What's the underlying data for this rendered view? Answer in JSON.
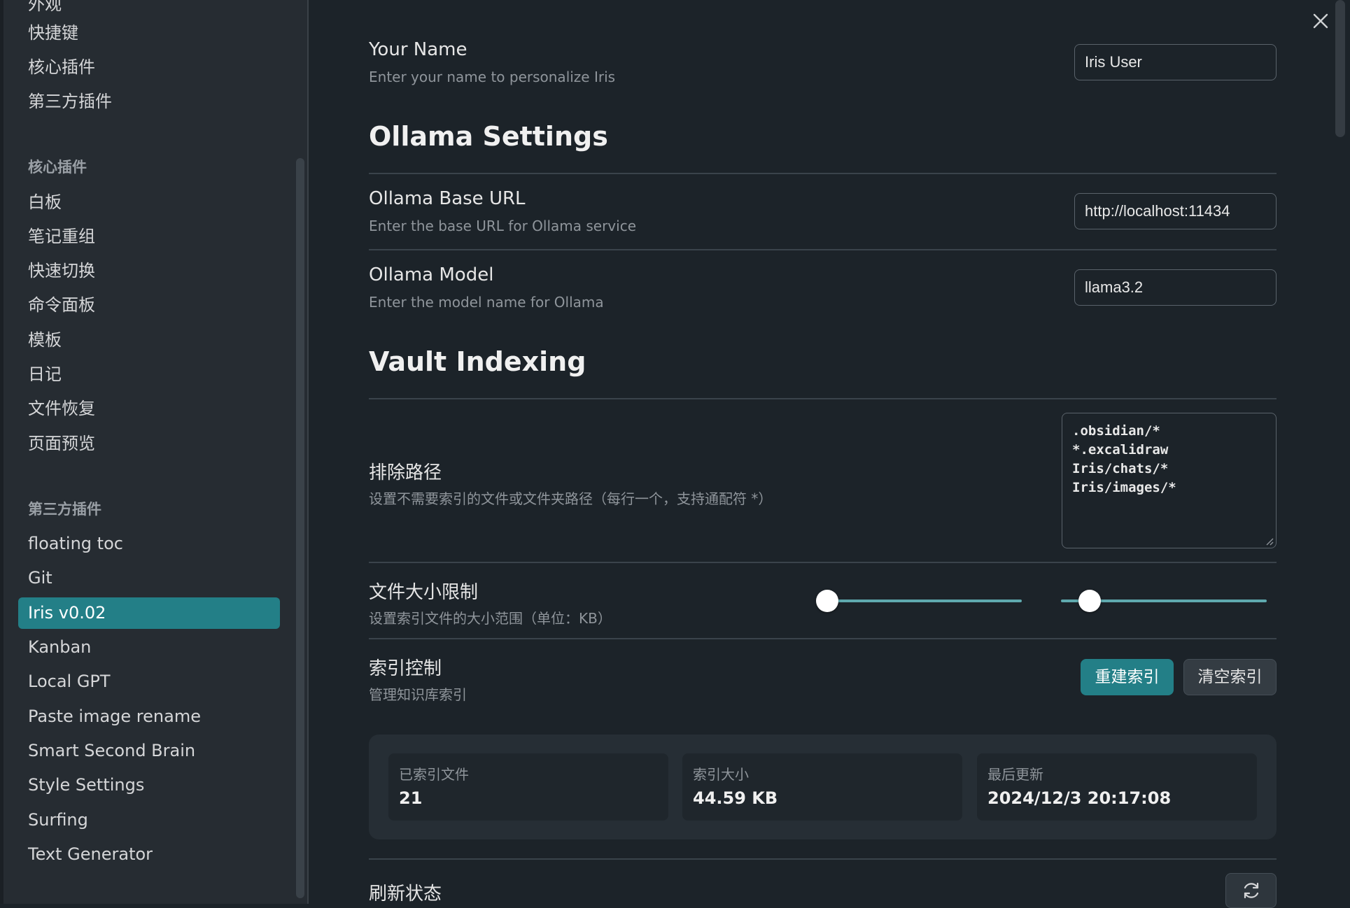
{
  "sidebar": {
    "items_top": [
      "外观",
      "快捷键",
      "核心插件",
      "第三方插件"
    ],
    "core_heading": "核心插件",
    "core_items": [
      "白板",
      "笔记重组",
      "快速切换",
      "命令面板",
      "模板",
      "日记",
      "文件恢复",
      "页面预览"
    ],
    "third_heading": "第三方插件",
    "third_items": [
      "floating toc",
      "Git",
      "Iris v0.02",
      "Kanban",
      "Local GPT",
      "Paste image rename",
      "Smart Second Brain",
      "Style Settings",
      "Surfing",
      "Text Generator"
    ],
    "active_item": "Iris v0.02"
  },
  "settings": {
    "your_name": {
      "name": "Your Name",
      "desc": "Enter your name to personalize Iris",
      "value": "Iris User"
    },
    "ollama_section": "Ollama Settings",
    "ollama_base_url": {
      "name": "Ollama Base URL",
      "desc": "Enter the base URL for Ollama service",
      "value": "http://localhost:11434"
    },
    "ollama_model": {
      "name": "Ollama Model",
      "desc": "Enter the model name for Ollama",
      "value": "llama3.2"
    },
    "vault_section": "Vault Indexing",
    "exclude_paths": {
      "name": "排除路径",
      "desc": "设置不需要索引的文件或文件夹路径（每行一个，支持通配符 *）",
      "lines": [
        ".obsidian/*",
        "*.excalidraw",
        "Iris/chats/*",
        "Iris/images/*"
      ]
    },
    "file_size": {
      "name": "文件大小限制",
      "desc": "设置索引文件的大小范围（单位：KB）",
      "min_slider_fraction": 0,
      "max_slider_fraction": 0.14
    },
    "index_control": {
      "name": "索引控制",
      "desc": "管理知识库索引",
      "rebuild_label": "重建索引",
      "clear_label": "清空索引"
    },
    "stats": {
      "indexed_files_label": "已索引文件",
      "indexed_files_value": "21",
      "index_size_label": "索引大小",
      "index_size_value": "44.59 KB",
      "last_updated_label": "最后更新",
      "last_updated_value": "2024/12/3 20:17:08"
    },
    "refresh_status": {
      "name": "刷新状态"
    }
  },
  "icons": {
    "close": "close-icon",
    "refresh": "refresh-icon"
  },
  "colors": {
    "accent": "#237f87",
    "background": "#1c2329",
    "sidebar": "#262c32"
  }
}
